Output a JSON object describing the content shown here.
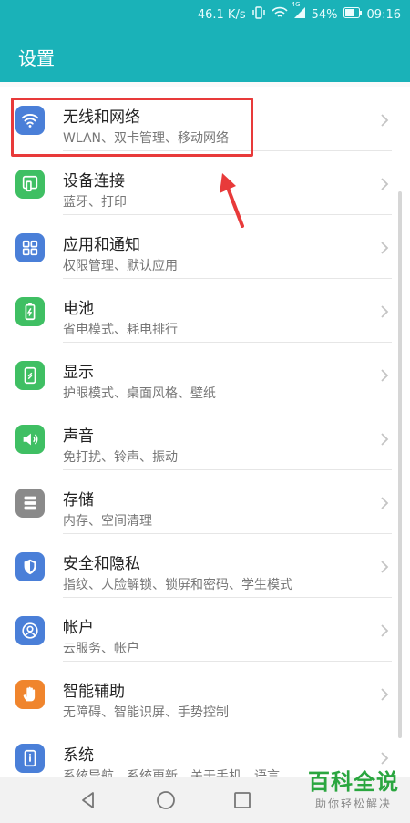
{
  "status_bar": {
    "speed": "46.1 K/s",
    "network_badge": "4G",
    "battery": "54%",
    "time": "09:16"
  },
  "header": {
    "title": "设置"
  },
  "settings": [
    {
      "title": "无线和网络",
      "subtitle": "WLAN、双卡管理、移动网络",
      "icon": "wifi-icon",
      "color": "#4a7fd8"
    },
    {
      "title": "设备连接",
      "subtitle": "蓝牙、打印",
      "icon": "device-connect-icon",
      "color": "#3fbf63"
    },
    {
      "title": "应用和通知",
      "subtitle": "权限管理、默认应用",
      "icon": "apps-grid-icon",
      "color": "#4a7fd8"
    },
    {
      "title": "电池",
      "subtitle": "省电模式、耗电排行",
      "icon": "battery-icon",
      "color": "#3fbf63"
    },
    {
      "title": "显示",
      "subtitle": "护眼模式、桌面风格、壁纸",
      "icon": "display-icon",
      "color": "#3fbf63"
    },
    {
      "title": "声音",
      "subtitle": "免打扰、铃声、振动",
      "icon": "speaker-icon",
      "color": "#3fbf63"
    },
    {
      "title": "存储",
      "subtitle": "内存、空间清理",
      "icon": "storage-icon",
      "color": "#8a8a8a"
    },
    {
      "title": "安全和隐私",
      "subtitle": "指纹、人脸解锁、锁屏和密码、学生模式",
      "icon": "shield-icon",
      "color": "#4a7fd8"
    },
    {
      "title": "帐户",
      "subtitle": "云服务、帐户",
      "icon": "account-icon",
      "color": "#4a7fd8"
    },
    {
      "title": "智能辅助",
      "subtitle": "无障碍、智能识屏、手势控制",
      "icon": "hand-icon",
      "color": "#f0852d"
    },
    {
      "title": "系统",
      "subtitle": "系统导航、系统更新、关于手机、语言",
      "icon": "system-info-icon",
      "color": "#4a7fd8"
    }
  ],
  "watermark": {
    "brand": "百科全说",
    "slogan": "助你轻松解决"
  },
  "colors": {
    "header": "#1ab2b8",
    "highlight": "#e83a3a"
  }
}
